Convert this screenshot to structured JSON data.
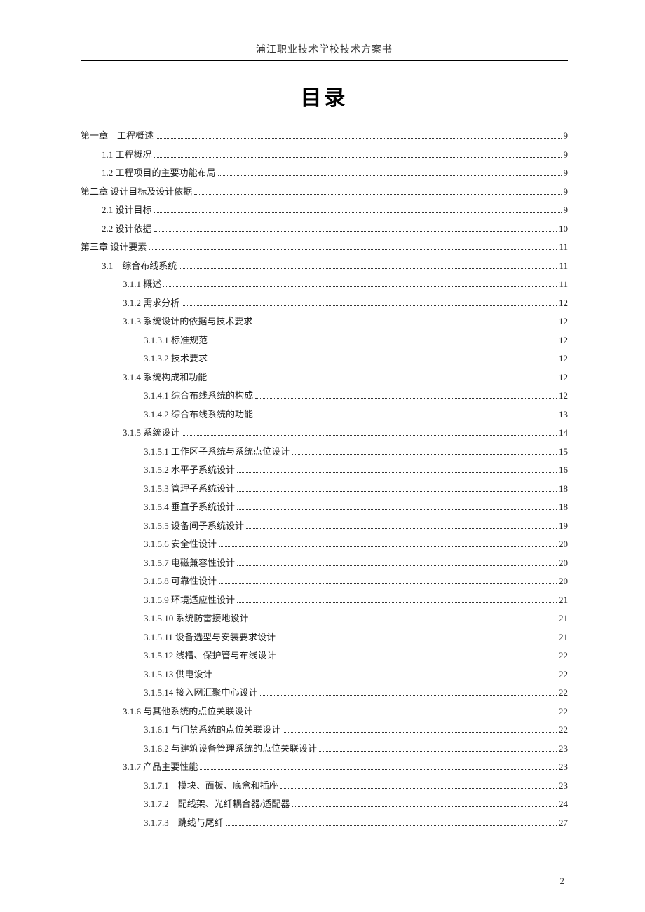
{
  "header": "浦江职业技术学校技术方案书",
  "title": "目录",
  "page_number": "2",
  "toc": [
    {
      "level": 1,
      "label": "第一章　工程概述",
      "page": "9"
    },
    {
      "level": 2,
      "label": "1.1 工程概况",
      "page": "9"
    },
    {
      "level": 2,
      "label": "1.2 工程项目的主要功能布局",
      "page": "9"
    },
    {
      "level": 1,
      "label": "第二章  设计目标及设计依据",
      "page": "9"
    },
    {
      "level": 2,
      "label": "2.1 设计目标",
      "page": "9"
    },
    {
      "level": 2,
      "label": "2.2 设计依据",
      "page": "10"
    },
    {
      "level": 1,
      "label": "第三章  设计要素",
      "page": "11"
    },
    {
      "level": 2,
      "label": "3.1　综合布线系统",
      "page": "11"
    },
    {
      "level": 3,
      "label": "3.1.1 概述",
      "page": "11"
    },
    {
      "level": 3,
      "label": "3.1.2 需求分析",
      "page": "12"
    },
    {
      "level": 3,
      "label": "3.1.3 系统设计的依据与技术要求",
      "page": "12"
    },
    {
      "level": 4,
      "label": "3.1.3.1 标准规范",
      "page": "12"
    },
    {
      "level": 4,
      "label": "3.1.3.2 技术要求",
      "page": "12"
    },
    {
      "level": 3,
      "label": "3.1.4 系统构成和功能",
      "page": "12"
    },
    {
      "level": 4,
      "label": "3.1.4.1 综合布线系统的构成",
      "page": "12"
    },
    {
      "level": 4,
      "label": "3.1.4.2 综合布线系统的功能",
      "page": "13"
    },
    {
      "level": 3,
      "label": "3.1.5 系统设计",
      "page": "14"
    },
    {
      "level": 4,
      "label": "3.1.5.1 工作区子系统与系统点位设计",
      "page": "15"
    },
    {
      "level": 4,
      "label": "3.1.5.2 水平子系统设计",
      "page": "16"
    },
    {
      "level": 4,
      "label": "3.1.5.3 管理子系统设计",
      "page": "18"
    },
    {
      "level": 4,
      "label": "3.1.5.4 垂直子系统设计",
      "page": "18"
    },
    {
      "level": 4,
      "label": "3.1.5.5 设备间子系统设计",
      "page": "19"
    },
    {
      "level": 4,
      "label": "3.1.5.6 安全性设计",
      "page": "20"
    },
    {
      "level": 4,
      "label": "3.1.5.7 电磁兼容性设计",
      "page": "20"
    },
    {
      "level": 4,
      "label": "3.1.5.8 可靠性设计",
      "page": "20"
    },
    {
      "level": 4,
      "label": "3.1.5.9 环境适应性设计",
      "page": "21"
    },
    {
      "level": 4,
      "label": "3.1.5.10 系统防雷接地设计",
      "page": "21"
    },
    {
      "level": 4,
      "label": "3.1.5.11 设备选型与安装要求设计",
      "page": "21"
    },
    {
      "level": 4,
      "label": "3.1.5.12 线槽、保护管与布线设计",
      "page": "22"
    },
    {
      "level": 4,
      "label": "3.1.5.13 供电设计",
      "page": "22"
    },
    {
      "level": 4,
      "label": "3.1.5.14 接入网汇聚中心设计",
      "page": "22"
    },
    {
      "level": 3,
      "label": "3.1.6 与其他系统的点位关联设计",
      "page": "22"
    },
    {
      "level": 4,
      "label": "3.1.6.1 与门禁系统的点位关联设计",
      "page": "22"
    },
    {
      "level": 4,
      "label": "3.1.6.2 与建筑设备管理系统的点位关联设计",
      "page": "23"
    },
    {
      "level": 3,
      "label": "3.1.7 产品主要性能",
      "page": "23"
    },
    {
      "level": 4,
      "label": "3.1.7.1　模块、面板、底盒和插座",
      "page": "23"
    },
    {
      "level": 4,
      "label": "3.1.7.2　配线架、光纤耦合器/适配器",
      "page": "24"
    },
    {
      "level": 4,
      "label": "3.1.7.3　跳线与尾纤",
      "page": "27"
    }
  ]
}
